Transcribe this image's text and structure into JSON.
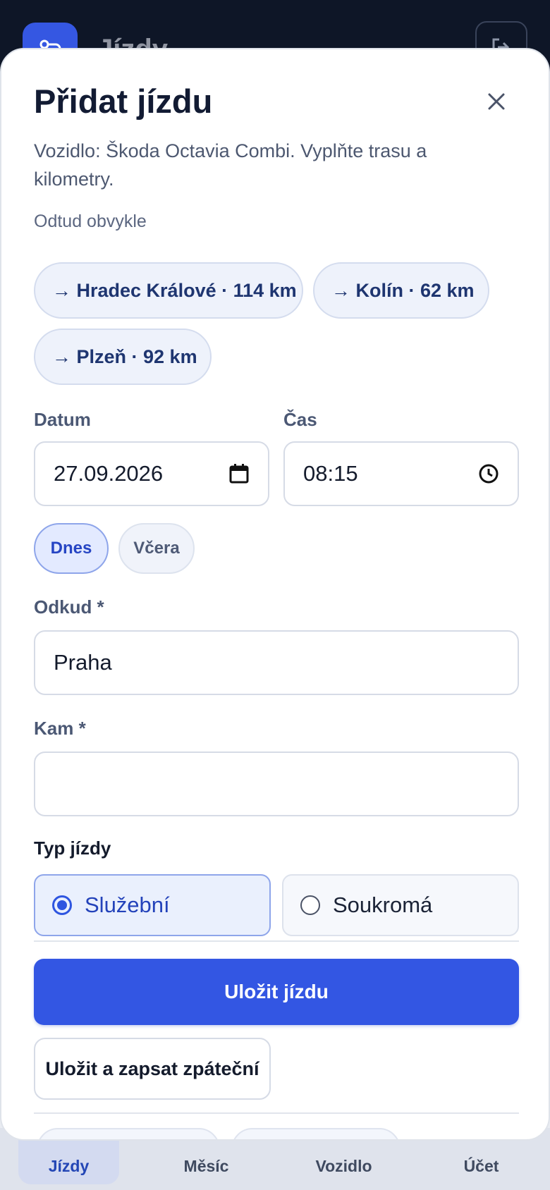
{
  "app": {
    "title": "Jízdy"
  },
  "modal": {
    "title": "Přidat jízdu",
    "subtitle": "Vozidlo: Škoda Octavia Combi. Vyplňte trasu a kilometry."
  },
  "frequent": {
    "label": "Odtud obvykle",
    "routes": [
      "→ Hradec Králové · 114 km",
      "→ Kolín · 62 km",
      "→ Plzeň · 92 km"
    ]
  },
  "date": {
    "label": "Datum",
    "value": "27.09.2026"
  },
  "time": {
    "label": "Čas",
    "value": "08:15"
  },
  "day_shortcuts": {
    "today": "Dnes",
    "yesterday": "Včera"
  },
  "from": {
    "label": "Odkud *",
    "value": "Praha"
  },
  "to": {
    "label": "Kam *",
    "value": ""
  },
  "trip_type": {
    "label": "Typ jízdy",
    "options": [
      "Služební",
      "Soukromá"
    ],
    "selected": "Služební"
  },
  "actions": {
    "save": "Uložit jízdu",
    "save_return": "Uložit a zapsat zpáteční"
  },
  "bottom_nav": {
    "items": [
      "Jízdy",
      "Měsíc",
      "Vozidlo",
      "Účet"
    ],
    "active": "Jízdy"
  },
  "colors": {
    "accent": "#3356e3",
    "header_bg": "#0e1627",
    "chip_bg": "#eef2fb"
  }
}
